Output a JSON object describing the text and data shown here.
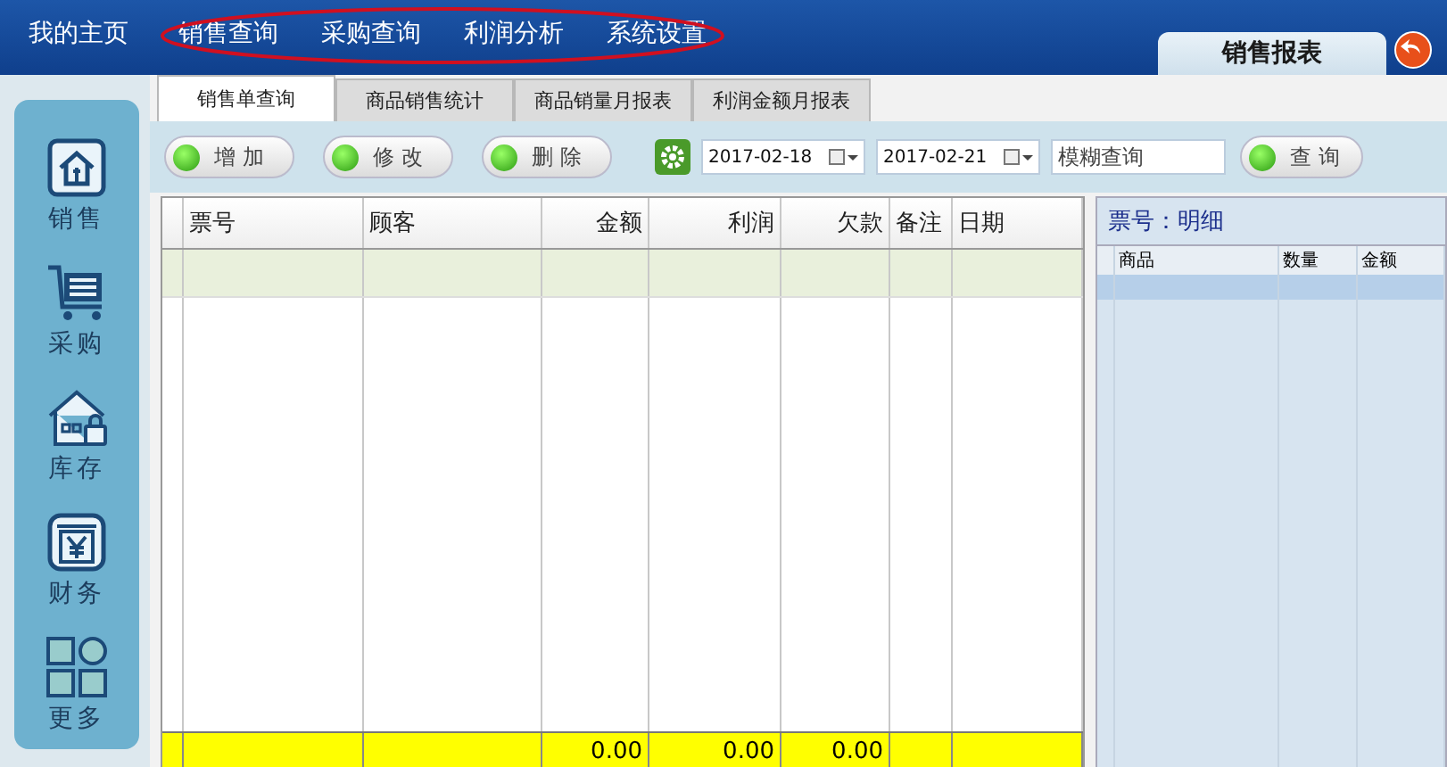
{
  "top_nav": {
    "items": [
      {
        "label": "我的主页"
      },
      {
        "label": "销售查询"
      },
      {
        "label": "采购查询"
      },
      {
        "label": "利润分析"
      },
      {
        "label": "系统设置"
      }
    ]
  },
  "report_tab": {
    "title": "销售报表"
  },
  "sidebar": {
    "items": [
      {
        "label": "销售",
        "kind": "sales"
      },
      {
        "label": "采购",
        "kind": "purchase"
      },
      {
        "label": "库存",
        "kind": "inventory"
      },
      {
        "label": "财务",
        "kind": "finance"
      },
      {
        "label": "更多",
        "kind": "more"
      }
    ]
  },
  "tabs": [
    {
      "label": "销售单查询",
      "selected": true
    },
    {
      "label": "商品销售统计",
      "selected": false
    },
    {
      "label": "商品销量月报表",
      "selected": false
    },
    {
      "label": "利润金额月报表",
      "selected": false
    }
  ],
  "toolbar": {
    "buttons": [
      {
        "label": "增加"
      },
      {
        "label": "修改"
      },
      {
        "label": "删除"
      }
    ],
    "date_from": "2017-02-18",
    "date_to": "2017-02-21",
    "search": {
      "placeholder": "模糊查询"
    },
    "search_button": "查询"
  },
  "table": {
    "columns": [
      {
        "label": "票号"
      },
      {
        "label": "顾客"
      },
      {
        "label": "金额",
        "total": "0.00"
      },
      {
        "label": "利润",
        "total": "0.00"
      },
      {
        "label": "欠款",
        "total": "0.00"
      },
      {
        "label": "备注"
      },
      {
        "label": "日期"
      }
    ],
    "rows": [
      {
        "selected": true
      }
    ]
  },
  "detail": {
    "title": "票号：明细",
    "columns": [
      "商品",
      "数量",
      "金额"
    ],
    "rows": [
      {
        "selected": true
      }
    ]
  }
}
